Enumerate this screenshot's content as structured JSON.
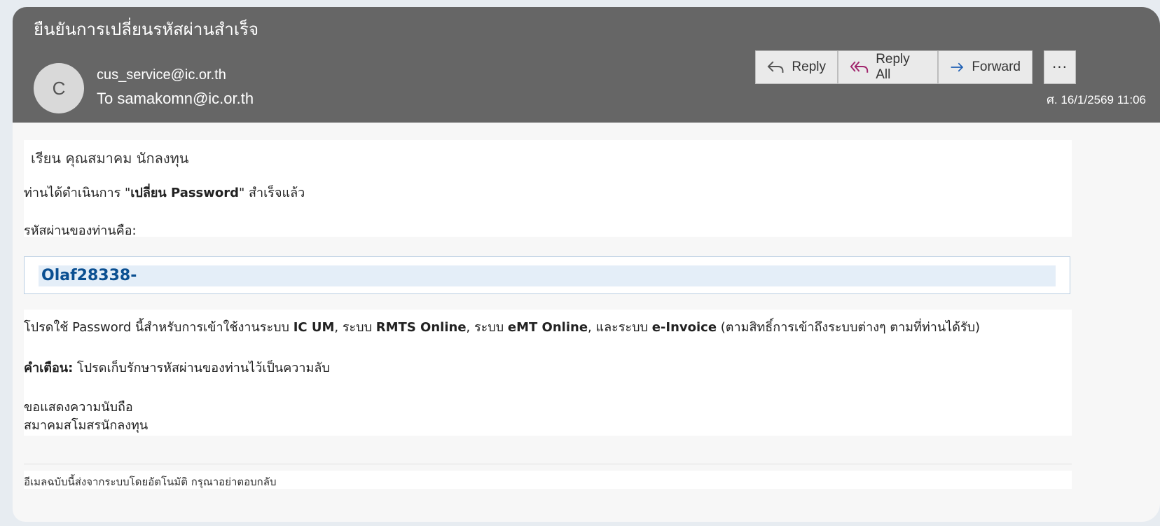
{
  "email": {
    "subject": "ยืนยันการเปลี่ยนรหัสผ่านสำเร็จ",
    "avatar_initial": "C",
    "from": "cus_service@ic.or.th",
    "to": "To samakomn@ic.or.th",
    "date": "ศ. 16/1/2569 11:06"
  },
  "actions": {
    "reply_label": "Reply",
    "reply_all_label": "Reply All",
    "forward_label": "Forward",
    "more_label": "···"
  },
  "body": {
    "greeting": "เรียน คุณสมาคม  นักลงทุน",
    "line1_pre": "ท่านได้ดำเนินการ \"",
    "line1_bold": "เปลี่ยน Password",
    "line1_post": "\" สำเร็จแล้ว",
    "pw_label": "รหัสผ่านของท่านคือ:",
    "password": "Olaf28338-",
    "usage_pre": "โปรดใช้ Password นี้สำหรับการเข้าใช้งานระบบ ",
    "usage_ic": "IC UM",
    "usage_sep1": ", ระบบ ",
    "usage_rmts": "RMTS Online",
    "usage_sep2": ", ระบบ ",
    "usage_emt": "eMT Online",
    "usage_sep3": ", และระบบ ",
    "usage_einv": "e-Invoice",
    "usage_post": " (ตามสิทธิ์การเข้าถึงระบบต่างๆ ตามที่ท่านได้รับ)",
    "warning_label": "คำเตือน:",
    "warning_text": " โปรดเก็บรักษารหัสผ่านของท่านไว้เป็นความลับ",
    "closing": "ขอแสดงความนับถือ",
    "signature": "สมาคมสโมสรนักลงทุน",
    "footer": "อีเมลฉบับนี้ส่งจากระบบโดยอัตโนมัติ กรุณาอย่าตอบกลับ"
  },
  "colors": {
    "header_bg": "#666666",
    "password_color": "#0a4f91",
    "reply_icon": "#555555",
    "reply_all_icon": "#a0246c",
    "forward_icon": "#1e5fb4"
  },
  "icons": [
    "reply-icon",
    "reply-all-icon",
    "forward-icon",
    "more-icon"
  ]
}
